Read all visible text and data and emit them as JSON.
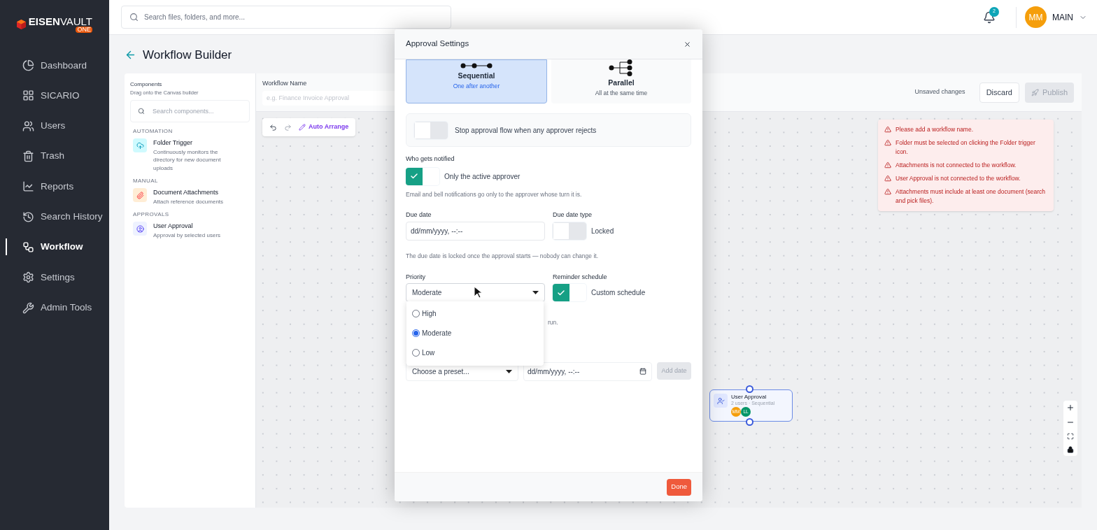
{
  "brand": {
    "name_bold": "EISEN",
    "name_light": "VAULT",
    "tag": "ONE"
  },
  "sidebar": {
    "items": [
      {
        "label": "Dashboard",
        "selected": false
      },
      {
        "label": "SICARIO",
        "selected": false
      },
      {
        "label": "Users",
        "selected": false
      },
      {
        "label": "Trash",
        "selected": false
      },
      {
        "label": "Reports",
        "selected": false
      },
      {
        "label": "Search History",
        "selected": false
      },
      {
        "label": "Workflow",
        "selected": true
      },
      {
        "label": "Settings",
        "selected": false
      },
      {
        "label": "Admin Tools",
        "selected": false
      }
    ]
  },
  "topbar": {
    "search_placeholder": "Search files, folders, and more...",
    "notification_count": "2",
    "avatar_initials": "MM",
    "user": "MAIN"
  },
  "page": {
    "title": "Workflow Builder"
  },
  "components_panel": {
    "title": "Components",
    "subtitle": "Drag onto the Canvas builder",
    "search_placeholder": "Search components...",
    "groups": [
      {
        "heading": "AUTOMATION",
        "items": [
          {
            "title": "Folder Trigger",
            "description": "Continuously monitors the directory for new document uploads",
            "color": "#cffafe"
          }
        ]
      },
      {
        "heading": "MANUAL",
        "items": [
          {
            "title": "Document Attachments",
            "description": "Attach reference documents",
            "color": "#ffedd5"
          }
        ]
      },
      {
        "heading": "APPROVALS",
        "items": [
          {
            "title": "User Approval",
            "description": "Approval by selected users",
            "color": "#eef2ff"
          }
        ]
      }
    ]
  },
  "workflow_name": {
    "label": "Workflow Name",
    "placeholder": "e.g. Finance Invoice Approval"
  },
  "save_status": "Unsaved changes",
  "actions": [
    {
      "label": "Discard",
      "disabled": false
    },
    {
      "label": "Publish",
      "disabled": true
    }
  ],
  "toolbar": {
    "action": "Auto Arrange"
  },
  "errors": [
    "Please add a workflow name.",
    "Folder must be selected on clicking the Folder trigger icon.",
    "Attachments is not connected to the workflow.",
    "User Approval is not connected to the workflow.",
    "Attachments must include at least one document (search and pick files)."
  ],
  "node": {
    "title": "User Approval",
    "subtitle": "2 users · Sequential",
    "avatars": [
      {
        "initials": "MM",
        "color": "#f59e0b"
      },
      {
        "initials": "LL",
        "color": "#059669"
      }
    ]
  },
  "modal": {
    "title": "Approval Settings",
    "modes": [
      {
        "title": "Sequential",
        "description": "One after another",
        "selected": true
      },
      {
        "title": "Parallel",
        "description": "All at the same time",
        "selected": false
      }
    ],
    "stop_on_reject": {
      "label": "Stop approval flow when any approver rejects",
      "on": false
    },
    "notify": {
      "label": "Who gets notified",
      "option": "Only the active approver",
      "on": true,
      "hint": "Email and bell notifications go only to the approver whose turn it is."
    },
    "due_date": {
      "label": "Due date",
      "placeholder": "dd/mm/yyyy, --:--"
    },
    "due_date_type": {
      "label": "Due date type",
      "option": "Locked",
      "on": false
    },
    "due_hint": "The due date is locked once the approval starts — nobody can change it.",
    "priority": {
      "label": "Priority",
      "value": "Moderate",
      "expanded": true,
      "options": [
        {
          "label": "High",
          "selected": false
        },
        {
          "label": "Moderate",
          "selected": true
        },
        {
          "label": "Low",
          "selected": false
        }
      ]
    },
    "reminder": {
      "label": "Reminder schedule",
      "option": "Custom schedule",
      "on": true,
      "hint_fragment": "run."
    },
    "preset": {
      "placeholder": "Choose a preset..."
    },
    "reminder_date": {
      "placeholder": "dd/mm/yyyy, --:--"
    },
    "add_date": {
      "label": "Add date",
      "disabled": true
    },
    "done": "Done"
  }
}
